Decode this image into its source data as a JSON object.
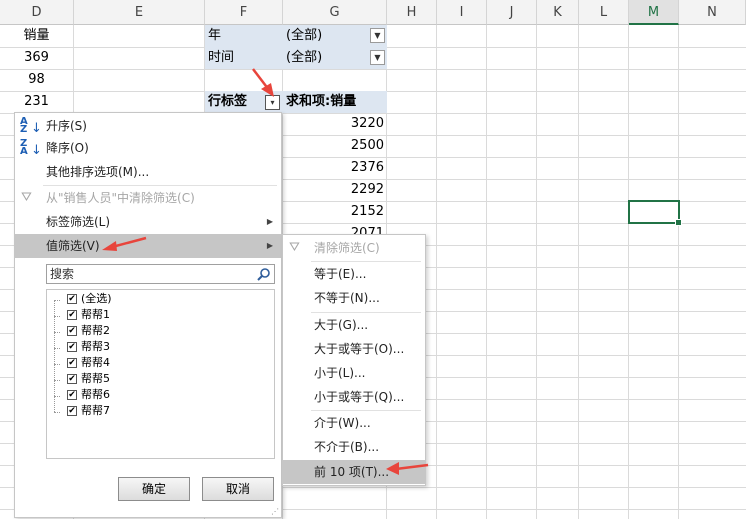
{
  "columns": [
    "D",
    "E",
    "F",
    "G",
    "H",
    "I",
    "J",
    "K",
    "L",
    "M",
    "N"
  ],
  "col_d_cells": [
    "销量",
    "369",
    "98",
    "231"
  ],
  "pivot": {
    "filter_year_label": "年",
    "filter_year_value": "(全部)",
    "filter_time_label": "时间",
    "filter_time_value": "(全部)",
    "row_label_header": "行标签",
    "sum_header": "求和项:销量",
    "values": [
      "3220",
      "2500",
      "2376",
      "2292",
      "2152",
      "2071"
    ]
  },
  "sort_filter_menu": {
    "items": [
      {
        "label": "升序(S)",
        "icon": "sort-asc-icon"
      },
      {
        "label": "降序(O)",
        "icon": "sort-desc-icon"
      },
      {
        "label": "其他排序选项(M)..."
      },
      {
        "label": "从\"销售人员\"中清除筛选(C)",
        "disabled": true,
        "icon": "clear-filter-icon"
      },
      {
        "label": "标签筛选(L)",
        "submenu": true
      },
      {
        "label": "值筛选(V)",
        "submenu": true,
        "highlighted": true
      }
    ],
    "search_placeholder": "搜索",
    "checklist": [
      "(全选)",
      "帮帮1",
      "帮帮2",
      "帮帮3",
      "帮帮4",
      "帮帮5",
      "帮帮6",
      "帮帮7"
    ],
    "ok_label": "确定",
    "cancel_label": "取消"
  },
  "value_filter_submenu": {
    "items": [
      {
        "label": "清除筛选(C)",
        "disabled": true,
        "icon": "clear-filter-icon"
      },
      {
        "label": "等于(E)..."
      },
      {
        "label": "不等于(N)..."
      },
      {
        "label": "大于(G)..."
      },
      {
        "label": "大于或等于(O)..."
      },
      {
        "label": "小于(L)..."
      },
      {
        "label": "小于或等于(Q)..."
      },
      {
        "label": "介于(W)..."
      },
      {
        "label": "不介于(B)..."
      },
      {
        "label": "前 10 项(T)...",
        "highlighted": true
      }
    ]
  },
  "colors": {
    "accent_green": "#217346",
    "highlight_gray": "#c6c6c6",
    "pivot_header_blue": "#dde6f1",
    "annotation_red": "#e8453c"
  }
}
